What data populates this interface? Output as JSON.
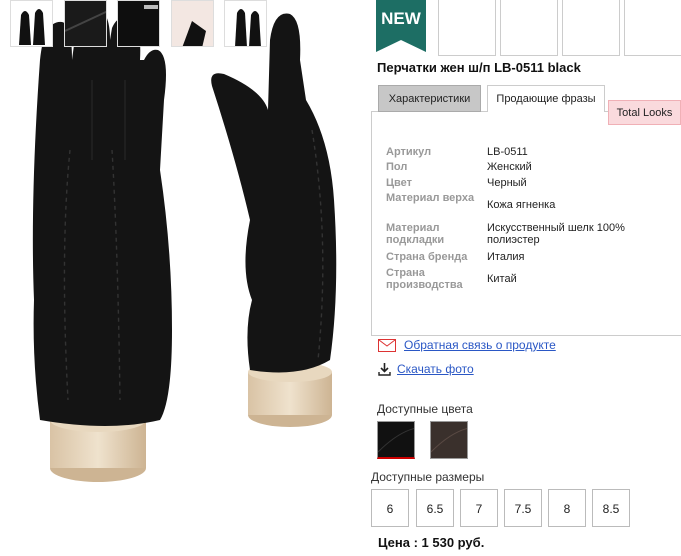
{
  "product": {
    "badge": "NEW",
    "title": "Перчатки жен ш/п LB-0511 black",
    "price": "Цена : 1 530 руб."
  },
  "tabs": [
    {
      "label": "Характеристики"
    },
    {
      "label": "Продающие фразы"
    },
    {
      "label": "Total Looks"
    }
  ],
  "specs": [
    {
      "key": "Артикул",
      "value": "LB-0511"
    },
    {
      "key": "Пол",
      "value": "Женский"
    },
    {
      "key": "Цвет",
      "value": "Черный"
    },
    {
      "key": "Материал верха",
      "value": "Кожа ягненка"
    },
    {
      "key": "Материал подкладки",
      "value": "Искусственный шелк 100% полиэстер"
    },
    {
      "key": "Страна бренда",
      "value": "Италия"
    },
    {
      "key": "Страна производства",
      "value": "Китай"
    }
  ],
  "links": {
    "feedback": "Обратная связь о продукте",
    "download_photo": "Скачать фото"
  },
  "colors": {
    "label": "Доступные цвета",
    "swatches": [
      {
        "name": "black",
        "color": "#111111",
        "selected": true
      },
      {
        "name": "dark-brown",
        "color": "#3a302c",
        "selected": false
      }
    ]
  },
  "sizes": {
    "label": "Доступные размеры",
    "options": [
      "6",
      "6.5",
      "7",
      "7.5",
      "8",
      "8.5"
    ]
  },
  "theme": {
    "badge_color": "#1d6e64",
    "link_color": "#2a57c5",
    "tab_active_bg": "#c7c7c7",
    "tab_pink_bg": "#fadadd"
  }
}
